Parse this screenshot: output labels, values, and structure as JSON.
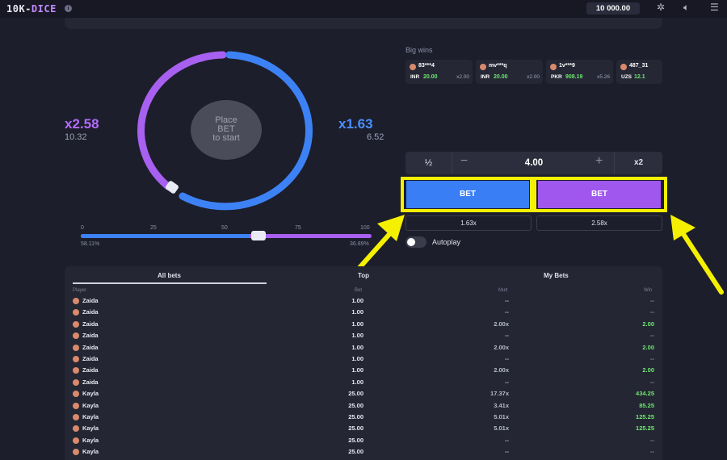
{
  "header": {
    "logo_main": "10K-",
    "logo_accent": "DICE",
    "info_icon": "info-icon",
    "balance": "10 000.00",
    "icons": [
      "settings-icon",
      "sound-icon",
      "menu-icon"
    ]
  },
  "game": {
    "left_mult": "x2.58",
    "left_value": "10.32",
    "right_mult": "x1.63",
    "right_value": "6.52",
    "center_lines": [
      "Place",
      "BET",
      "to start"
    ],
    "slider_ticks": [
      "0",
      "25",
      "50",
      "75",
      "100"
    ],
    "slider_value": 0.58,
    "left_pct": "58.11%",
    "right_pct": "36.89%",
    "colors": {
      "blue": "#3a7ef6",
      "purple": "#a057ee",
      "highlight": "#f5f000"
    }
  },
  "big_wins": {
    "title": "Big wins",
    "cards": [
      {
        "name": "83***4",
        "currency": "INR",
        "amount": "20.00",
        "mult": "x2.00"
      },
      {
        "name": "mv***q",
        "currency": "INR",
        "amount": "20.00",
        "mult": "x2.00"
      },
      {
        "name": "1v***9",
        "currency": "PKR",
        "amount": "908.19",
        "mult": "x5.26"
      },
      {
        "name": "487_31",
        "currency": "UZS",
        "amount": "12.1",
        "mult": ""
      }
    ]
  },
  "bet_controls": {
    "half": "½",
    "minus": "−",
    "amount": "4.00",
    "plus": "+",
    "double": "x2",
    "bet_blue": "BET",
    "bet_purple": "BET",
    "mult_blue": "1.63x",
    "mult_purple": "2.58x",
    "autoplay": "Autoplay"
  },
  "bets_table": {
    "tabs": [
      "All bets",
      "Top",
      "My Bets"
    ],
    "headers": [
      "Player",
      "Bet",
      "Mult",
      "Win"
    ],
    "rows": [
      {
        "player": "Zaida",
        "bet": "1.00",
        "mult": "--",
        "win": "--"
      },
      {
        "player": "Zaida",
        "bet": "1.00",
        "mult": "--",
        "win": "--"
      },
      {
        "player": "Zaida",
        "bet": "1.00",
        "mult": "2.00x",
        "win": "2.00"
      },
      {
        "player": "Zaida",
        "bet": "1.00",
        "mult": "--",
        "win": "--"
      },
      {
        "player": "Zaida",
        "bet": "1.00",
        "mult": "2.00x",
        "win": "2.00"
      },
      {
        "player": "Zaida",
        "bet": "1.00",
        "mult": "--",
        "win": "--"
      },
      {
        "player": "Zaida",
        "bet": "1.00",
        "mult": "2.00x",
        "win": "2.00"
      },
      {
        "player": "Zaida",
        "bet": "1.00",
        "mult": "--",
        "win": "--"
      },
      {
        "player": "Kayla",
        "bet": "25.00",
        "mult": "17.37x",
        "win": "434.25"
      },
      {
        "player": "Kayla",
        "bet": "25.00",
        "mult": "3.41x",
        "win": "85.25"
      },
      {
        "player": "Kayla",
        "bet": "25.00",
        "mult": "5.01x",
        "win": "125.25"
      },
      {
        "player": "Kayla",
        "bet": "25.00",
        "mult": "5.01x",
        "win": "125.25"
      },
      {
        "player": "Kayla",
        "bet": "25.00",
        "mult": "--",
        "win": "--"
      },
      {
        "player": "Kayla",
        "bet": "25.00",
        "mult": "--",
        "win": "--"
      }
    ]
  }
}
